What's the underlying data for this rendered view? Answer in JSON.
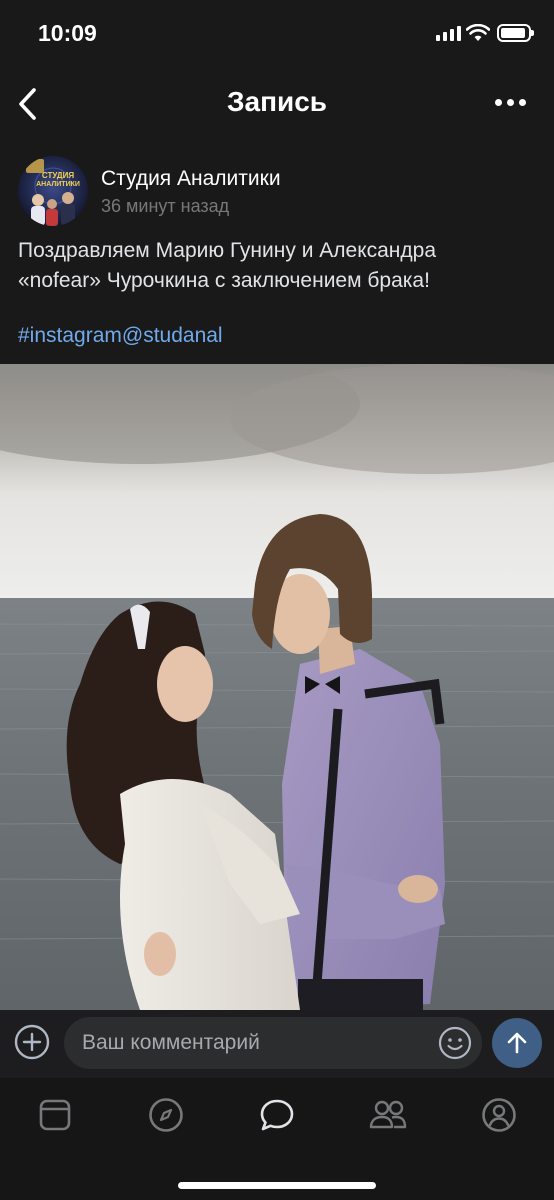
{
  "status": {
    "time": "10:09"
  },
  "nav": {
    "title": "Запись"
  },
  "post": {
    "author": "Студия Аналитики",
    "time_ago": "36 минут назад",
    "text_line1": "Поздравляем Марию Гунину и Александра",
    "text_line2": "«nofear» Чурочкина с заключением брака!",
    "hashtag": "#instagram@studanal",
    "avatar_text_line1": "СТУДИЯ",
    "avatar_text_line2": "АНАЛИТИКИ"
  },
  "comment": {
    "placeholder": "Ваш комментарий"
  },
  "tabs": [
    {
      "icon": "newsfeed-icon"
    },
    {
      "icon": "compass-icon"
    },
    {
      "icon": "messages-icon"
    },
    {
      "icon": "friends-icon"
    },
    {
      "icon": "profile-icon"
    }
  ],
  "colors": {
    "accent": "#71aaeb",
    "send": "#3f5f86",
    "background": "#19191a"
  }
}
